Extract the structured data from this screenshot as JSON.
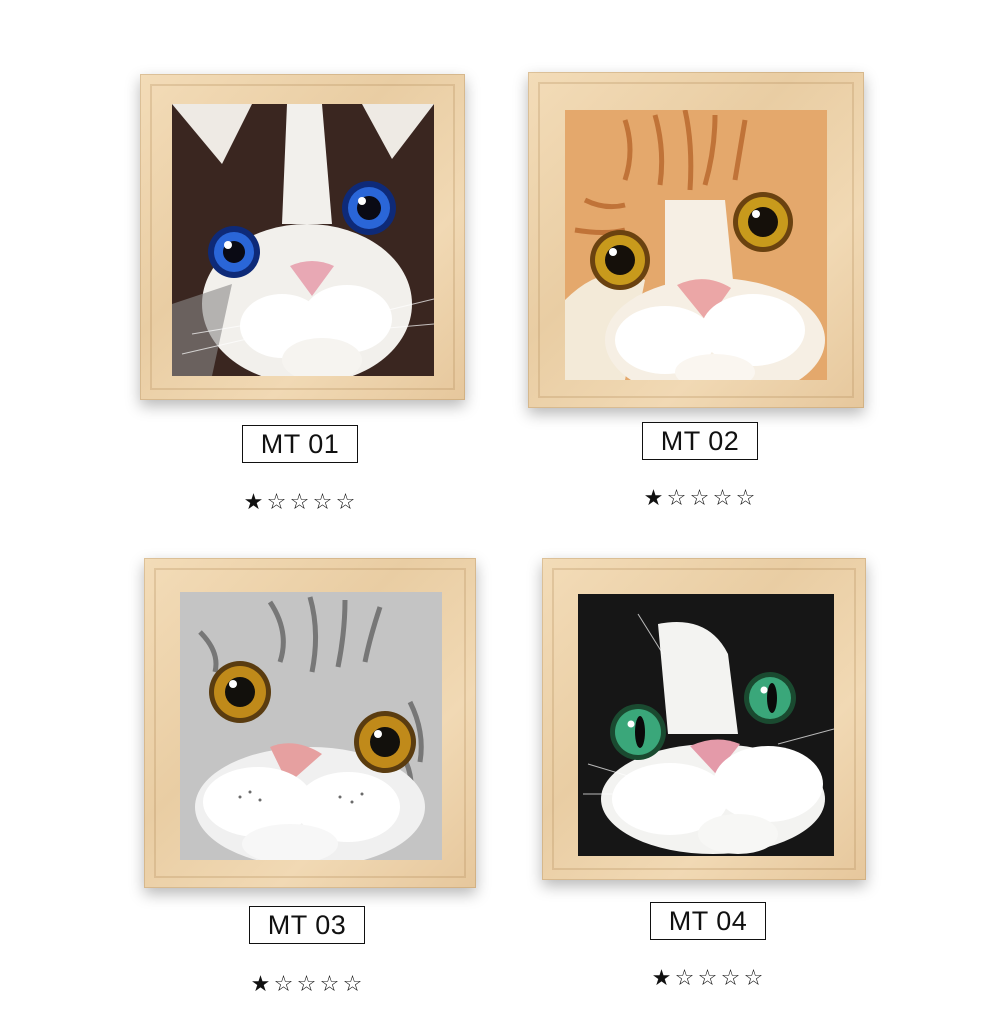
{
  "products": [
    {
      "label": "MT 01",
      "rating": 1,
      "max_rating": 5,
      "colors": {
        "fur_main": "#3a2620",
        "fur_accent": "#f2f0ec",
        "eye": "#1f55c8",
        "nose": "#e8a8b4"
      },
      "icon": "cat-face-icon"
    },
    {
      "label": "MT 02",
      "rating": 1,
      "max_rating": 5,
      "colors": {
        "fur_main": "#e0a064",
        "fur_accent": "#f6efe4",
        "eye": "#c89a1c",
        "nose": "#eba6a6"
      },
      "icon": "cat-face-icon"
    },
    {
      "label": "MT 03",
      "rating": 1,
      "max_rating": 5,
      "colors": {
        "fur_main": "#b9b9b9",
        "fur_accent": "#f2f2f2",
        "eye": "#c08a1a",
        "nose": "#e6a0a0"
      },
      "icon": "cat-face-icon"
    },
    {
      "label": "MT 04",
      "rating": 1,
      "max_rating": 5,
      "colors": {
        "fur_main": "#141414",
        "fur_accent": "#f3f3f1",
        "eye": "#3aa77a",
        "nose": "#e49aa9"
      },
      "icon": "cat-face-icon"
    }
  ],
  "star_filled": "★",
  "star_empty": "☆"
}
